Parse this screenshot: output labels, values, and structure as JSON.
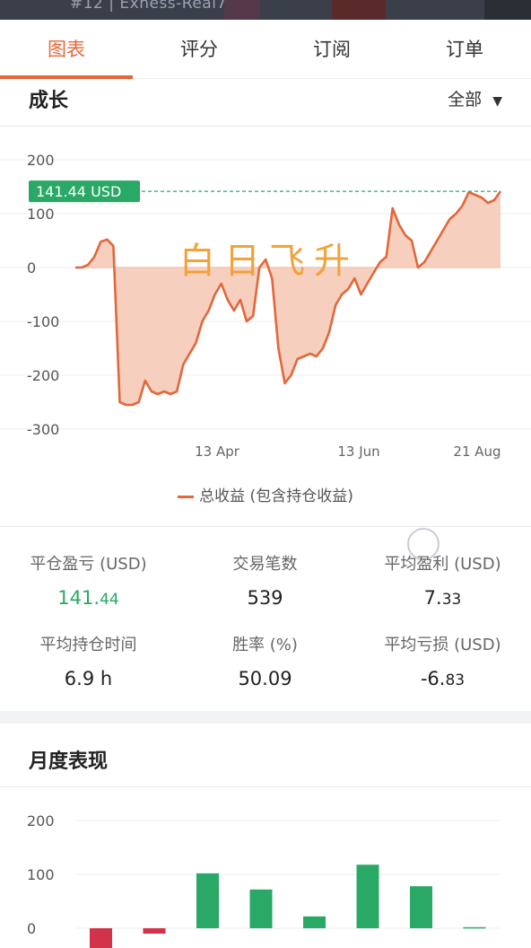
{
  "topbar": {
    "account": "#12 | Exness-Real7"
  },
  "tabs": [
    "图表",
    "评分",
    "订阅",
    "订单"
  ],
  "growth": {
    "title": "成长",
    "range": "全部",
    "range_icon": "caret-down-icon",
    "current_label": "141.44 USD",
    "legend": "总收益 (包含持仓收益)",
    "handwriting": "白日飞升"
  },
  "stats": [
    {
      "label": "平仓盈亏 (USD)",
      "value_main": "141.",
      "value_small": "44",
      "color": "#2aa866"
    },
    {
      "label": "交易笔数",
      "value_main": "539",
      "value_small": "",
      "color": "#222222"
    },
    {
      "label": "平均盈利 (USD)",
      "value_main": "7.",
      "value_small": "33",
      "color": "#222222"
    },
    {
      "label": "平均持仓时间",
      "value_main": "6.9 h",
      "value_small": "",
      "color": "#222222"
    },
    {
      "label": "胜率 (%)",
      "value_main": "50.09",
      "value_small": "",
      "color": "#222222"
    },
    {
      "label": "平均亏损 (USD)",
      "value_main": "-6.",
      "value_small": "83",
      "color": "#222222"
    }
  ],
  "monthly": {
    "title": "月度表现"
  },
  "chart_data": [
    {
      "type": "area",
      "ylim": [
        -300,
        200
      ],
      "yticks": [
        200,
        100,
        0,
        -100,
        -200,
        -300
      ],
      "xtick_labels": [
        "13 Apr",
        "13 Jun",
        "21 Aug"
      ],
      "current_value": 141.44,
      "colors": {
        "line": "#e2673a",
        "fill": "#f6c7b3",
        "marker": "#2aa866"
      },
      "series": [
        {
          "name": "总收益 (包含持仓收益)",
          "values": [
            0,
            0,
            5,
            20,
            48,
            52,
            40,
            -250,
            -255,
            -255,
            -250,
            -210,
            -230,
            -235,
            -230,
            -235,
            -230,
            -180,
            -160,
            -140,
            -100,
            -80,
            -50,
            -30,
            -60,
            -80,
            -60,
            -100,
            -90,
            0,
            15,
            -20,
            -150,
            -215,
            -200,
            -170,
            -165,
            -160,
            -165,
            -150,
            -120,
            -70,
            -50,
            -40,
            -20,
            -50,
            -30,
            -10,
            10,
            20,
            110,
            80,
            60,
            50,
            0,
            10,
            30,
            50,
            70,
            90,
            100,
            115,
            140,
            135,
            130,
            120,
            125,
            141.44
          ]
        }
      ]
    },
    {
      "type": "bar",
      "ylim": [
        0,
        200
      ],
      "yticks": [
        200,
        100,
        0
      ],
      "colors": {
        "positive": "#2aa866",
        "negative": "#d2334a"
      },
      "series": [
        {
          "values": [
            -40,
            -10,
            102,
            72,
            22,
            118,
            78,
            2
          ]
        }
      ]
    }
  ]
}
